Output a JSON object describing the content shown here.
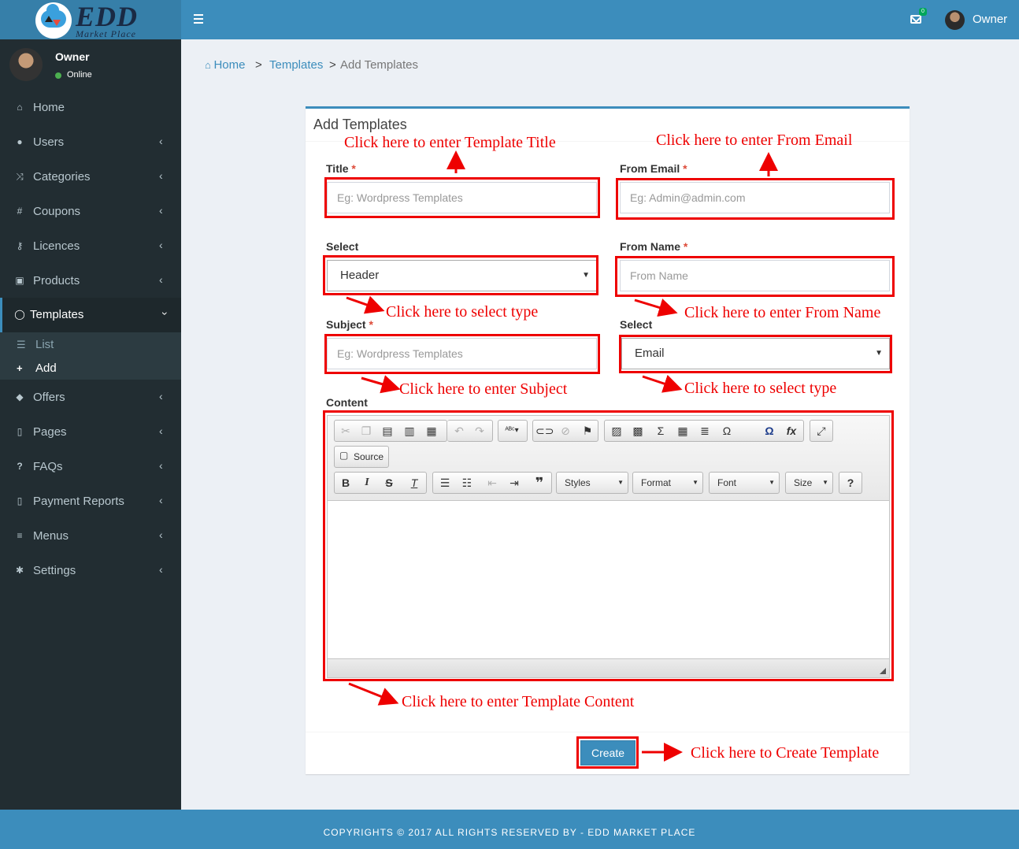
{
  "brand": {
    "title": "EDD",
    "subtitle": "Market Place"
  },
  "topbar": {
    "mail_badge": "0",
    "user": "Owner"
  },
  "user_panel": {
    "name": "Owner",
    "status": "Online"
  },
  "sidebar": {
    "items": [
      {
        "label": "Home",
        "icon": "home-icon"
      },
      {
        "label": "Users",
        "icon": "users-icon"
      },
      {
        "label": "Categories",
        "icon": "shuffle-icon"
      },
      {
        "label": "Coupons",
        "icon": "hash-icon"
      },
      {
        "label": "Licences",
        "icon": "key-icon"
      },
      {
        "label": "Products",
        "icon": "briefcase-icon"
      },
      {
        "label": "Templates",
        "icon": "comment-icon"
      },
      {
        "label": "Offers",
        "icon": "tags-icon"
      },
      {
        "label": "Pages",
        "icon": "file-icon"
      },
      {
        "label": "FAQs",
        "icon": "question-icon"
      },
      {
        "label": "Payment Reports",
        "icon": "file-icon"
      },
      {
        "label": "Menus",
        "icon": "bars-icon"
      },
      {
        "label": "Settings",
        "icon": "gear-icon"
      }
    ],
    "templates_sub": [
      {
        "label": "List"
      },
      {
        "label": "Add"
      }
    ]
  },
  "breadcrumb": {
    "home": "Home",
    "templates": "Templates",
    "current": "Add Templates",
    "sep": ">"
  },
  "form": {
    "box_title": "Add Templates",
    "title_label": "Title",
    "title_placeholder": "Eg: Wordpress Templates",
    "from_email_label": "From Email",
    "from_email_placeholder": "Eg: Admin@admin.com",
    "select_label": "Select",
    "select_value": "Header",
    "from_name_label": "From Name",
    "from_name_placeholder": "From Name",
    "subject_label": "Subject",
    "subject_placeholder": "Eg: Wordpress Templates",
    "select2_label": "Select",
    "select2_value": "Email",
    "content_label": "Content",
    "required_mark": "*",
    "create_label": "Create"
  },
  "editor": {
    "source_label": "Source",
    "styles_label": "Styles",
    "format_label": "Format",
    "font_label": "Font",
    "size_label": "Size"
  },
  "annotations": {
    "title": "Click here to enter Template Title",
    "from_email": "Click here to enter From Email",
    "select_type": "Click here to select type",
    "from_name": "Click here to enter From Name",
    "subject": "Click here to enter Subject",
    "select_type2": "Click here to select type",
    "content": "Click here to enter Template Content",
    "create": "Click here to Create Template",
    "color": "#ee0000"
  },
  "footer": {
    "text": "COPYRIGHTS © 2017 ALL RIGHTS RESERVED BY - EDD MARKET PLACE"
  },
  "colors": {
    "primary": "#3c8dbc",
    "sidebar": "#222d32",
    "required": "#dd4b39"
  }
}
